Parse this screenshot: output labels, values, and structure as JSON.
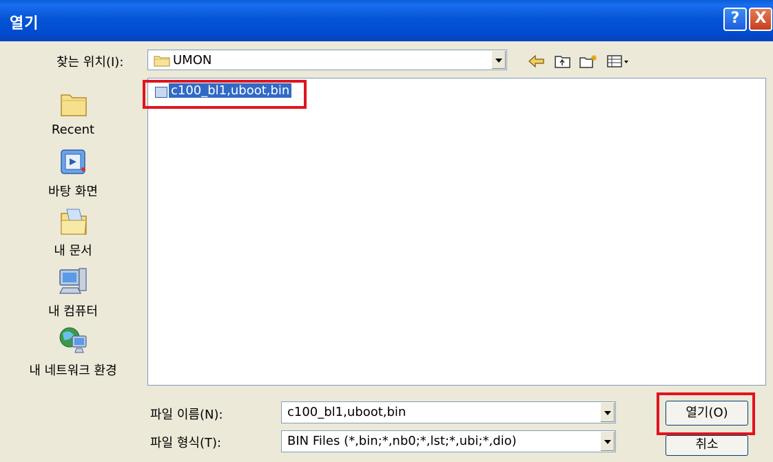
{
  "window": {
    "title": "열기"
  },
  "titlebar_buttons": {
    "help": "?",
    "close": "X"
  },
  "look_in": {
    "label": "찾는 위치(I):",
    "value": "UMON"
  },
  "toolbar": {
    "icons": [
      "back-icon",
      "up-folder-icon",
      "new-folder-icon",
      "view-menu-icon"
    ]
  },
  "places": [
    {
      "label": "Recent",
      "icon": "recent-folder-icon"
    },
    {
      "label": "바탕 화면",
      "icon": "desktop-icon"
    },
    {
      "label": "내 문서",
      "icon": "my-documents-icon"
    },
    {
      "label": "내 컴퓨터",
      "icon": "my-computer-icon"
    },
    {
      "label": "내 네트워크 환경",
      "icon": "network-icon"
    }
  ],
  "files": [
    {
      "name": "c100_bl1,uboot,bin",
      "selected": true
    }
  ],
  "filename": {
    "label": "파일 이름(N):",
    "value": "c100_bl1,uboot,bin"
  },
  "filetype": {
    "label": "파일 형식(T):",
    "value": "BIN Files (*,bin;*,nb0;*,lst;*,ubi;*,dio)"
  },
  "buttons": {
    "open": "열기(O)",
    "cancel": "취소"
  },
  "colors": {
    "titlebar": "#0555d6",
    "selection": "#316ac5",
    "highlight_box": "#e0141e",
    "dialog_bg": "#ece9d8"
  }
}
